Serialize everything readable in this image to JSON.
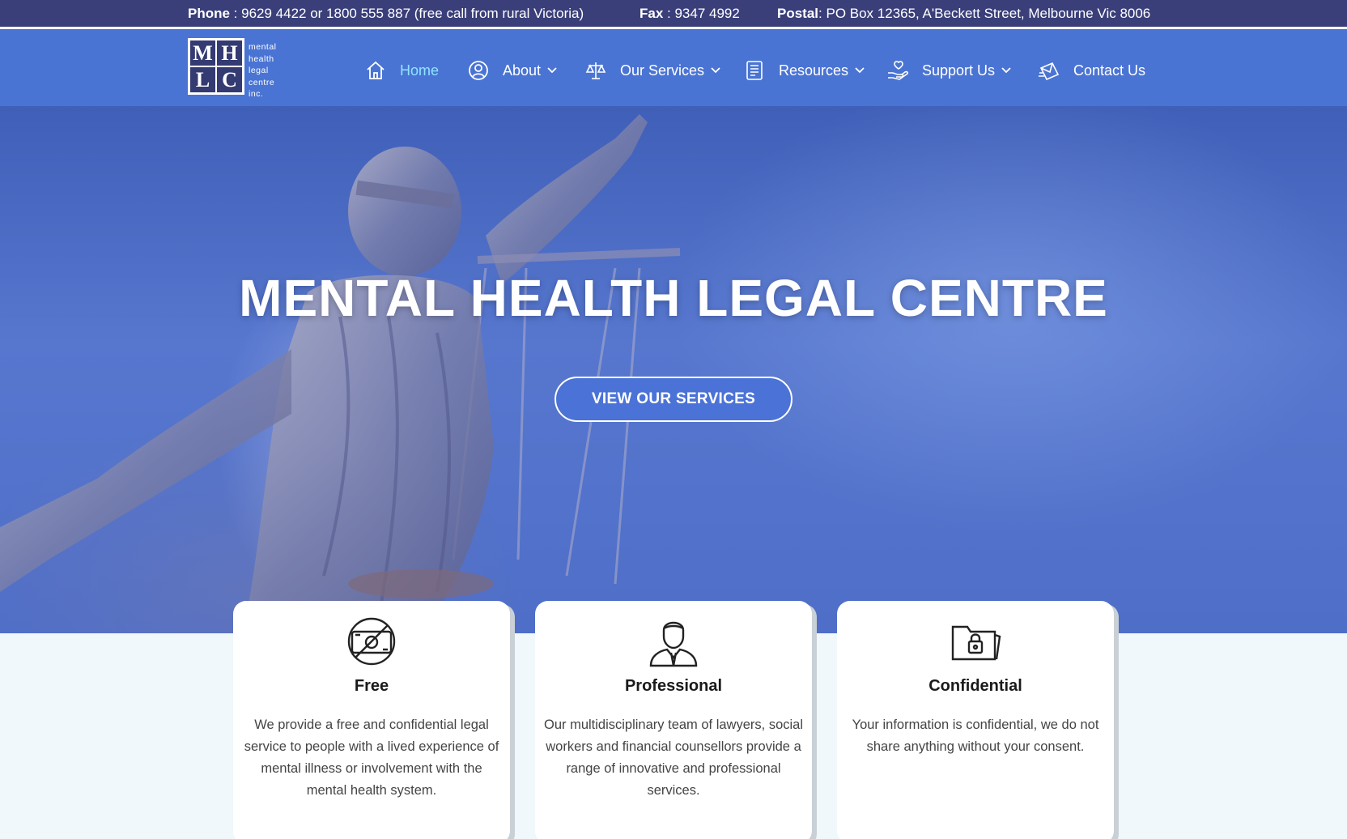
{
  "topbar": {
    "phone_label": "Phone",
    "phone_value": " : 9629 4422 or 1800 555 887 (free call from rural Victoria)",
    "fax_label": "Fax",
    "fax_value": " : 9347 4992",
    "postal_label": "Postal",
    "postal_value": ": PO Box 12365, A'Beckett Street, Melbourne Vic 8006"
  },
  "logo": {
    "letters": [
      "M",
      "H",
      "L",
      "C"
    ],
    "text_lines": [
      "mental",
      "health",
      "legal",
      "centre",
      "inc."
    ]
  },
  "nav": {
    "items": [
      {
        "label": "Home",
        "icon": "home-icon",
        "active": true
      },
      {
        "label": "About",
        "icon": "user-circle-icon",
        "dropdown": true
      },
      {
        "label": "Our Services",
        "icon": "scales-icon",
        "dropdown": true
      },
      {
        "label": "Resources",
        "icon": "document-icon",
        "dropdown": true
      },
      {
        "label": "Support Us",
        "icon": "hand-heart-icon",
        "dropdown": true
      },
      {
        "label": "Contact Us",
        "icon": "envelope-icon"
      }
    ]
  },
  "hero": {
    "title": "MENTAL HEALTH LEGAL CENTRE",
    "button_label": "VIEW OUR SERVICES"
  },
  "features": [
    {
      "title": "Free",
      "icon": "no-money-icon",
      "body": "We provide a free and confidential legal service to people with a lived experience of mental illness or involvement with the mental health system."
    },
    {
      "title": "Professional",
      "icon": "professional-person-icon",
      "body": "Our multidisciplinary team of lawyers, social workers and financial counsellors provide a range of innovative and professional services."
    },
    {
      "title": "Confidential",
      "icon": "locked-folder-icon",
      "body": "Your information is confidential, we do not share anything without your consent."
    }
  ],
  "colors": {
    "topbar": "#3a3f7a",
    "navbar": "#4a74d3",
    "nav_active": "#8fe4ff",
    "button": "#4b72d6",
    "page_bg": "#f1f8fb"
  }
}
